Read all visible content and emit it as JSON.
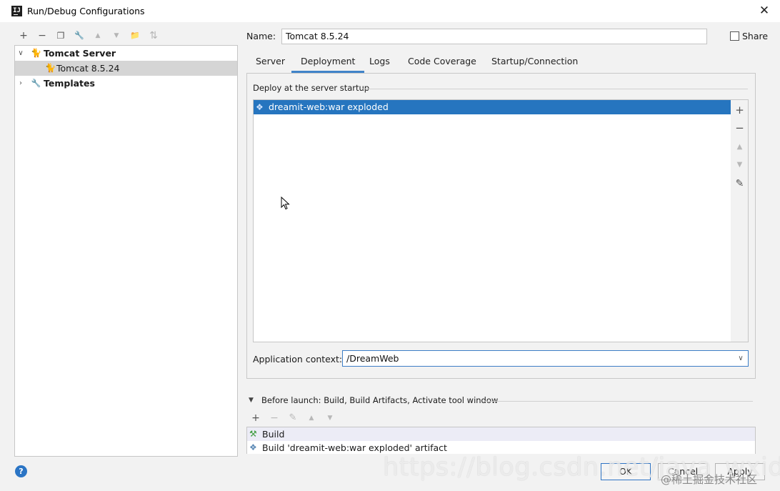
{
  "window": {
    "title": "Run/Debug Configurations",
    "app_icon_text": "IJ",
    "close_glyph": "✕"
  },
  "toolbar": {
    "icons": [
      {
        "name": "add-icon",
        "glyph": "+",
        "enabled": true
      },
      {
        "name": "remove-icon",
        "glyph": "−",
        "enabled": true
      },
      {
        "name": "copy-icon",
        "glyph": "❐",
        "enabled": true
      },
      {
        "name": "wrench-icon",
        "glyph": "🔧",
        "enabled": true
      },
      {
        "name": "move-up-icon",
        "glyph": "▲",
        "enabled": false
      },
      {
        "name": "move-down-icon",
        "glyph": "▼",
        "enabled": false
      },
      {
        "name": "folder-icon",
        "glyph": "📁",
        "enabled": true
      },
      {
        "name": "sort-icon",
        "glyph": "⇅",
        "enabled": false
      }
    ]
  },
  "tree": {
    "items": [
      {
        "label": "Tomcat Server",
        "bold": true,
        "expanded": true,
        "icon": "tomcat-icon",
        "level": 0
      },
      {
        "label": "Tomcat 8.5.24",
        "bold": false,
        "selected": true,
        "icon": "tomcat-icon",
        "level": 1
      },
      {
        "label": "Templates",
        "bold": true,
        "expanded": false,
        "icon": "wrench-icon",
        "level": 0
      }
    ]
  },
  "name": {
    "label": "Name:",
    "value": "Tomcat 8.5.24"
  },
  "share": {
    "label": "Share",
    "checked": false
  },
  "tabs": [
    {
      "label": "Server",
      "active": false
    },
    {
      "label": "Deployment",
      "active": true
    },
    {
      "label": "Logs",
      "active": false
    },
    {
      "label": "Code Coverage",
      "active": false
    },
    {
      "label": "Startup/Connection",
      "active": false
    }
  ],
  "deployment": {
    "group_title": "Deploy at the server startup",
    "items": [
      {
        "label": "dreamit-web:war exploded",
        "selected": true,
        "icon": "artifact-icon"
      }
    ],
    "side_tools": [
      {
        "name": "add-icon",
        "glyph": "+",
        "enabled": true
      },
      {
        "name": "remove-icon",
        "glyph": "−",
        "enabled": true
      },
      {
        "name": "move-up-icon",
        "glyph": "▲",
        "enabled": false
      },
      {
        "name": "move-down-icon",
        "glyph": "▼",
        "enabled": false
      },
      {
        "name": "edit-icon",
        "glyph": "✎",
        "enabled": true
      }
    ],
    "app_context_label": "Application context:",
    "app_context_value": "/DreamWeb"
  },
  "before_launch": {
    "title": "Before launch: Build, Build Artifacts, Activate tool window",
    "tools": [
      {
        "name": "add-icon",
        "glyph": "+",
        "enabled": true
      },
      {
        "name": "remove-icon",
        "glyph": "−",
        "enabled": false
      },
      {
        "name": "edit-icon",
        "glyph": "✎",
        "enabled": false
      },
      {
        "name": "move-up-icon",
        "glyph": "▲",
        "enabled": false
      },
      {
        "name": "move-down-icon",
        "glyph": "▼",
        "enabled": false
      }
    ],
    "items": [
      {
        "label": "Build",
        "icon": "hammer-icon"
      },
      {
        "label": "Build 'dreamit-web:war exploded' artifact",
        "icon": "artifact-icon"
      }
    ]
  },
  "buttons": {
    "ok": "OK",
    "cancel": "Cancel",
    "apply": "Apply",
    "help_glyph": "?"
  },
  "watermark": {
    "url_text": "https://blog.csdn.net/java_wxid",
    "site_text": "@稀土掘金技术社区"
  },
  "colors": {
    "selection": "#2675bf",
    "tab_underline": "#4083c9",
    "help": "#2b75c5"
  }
}
